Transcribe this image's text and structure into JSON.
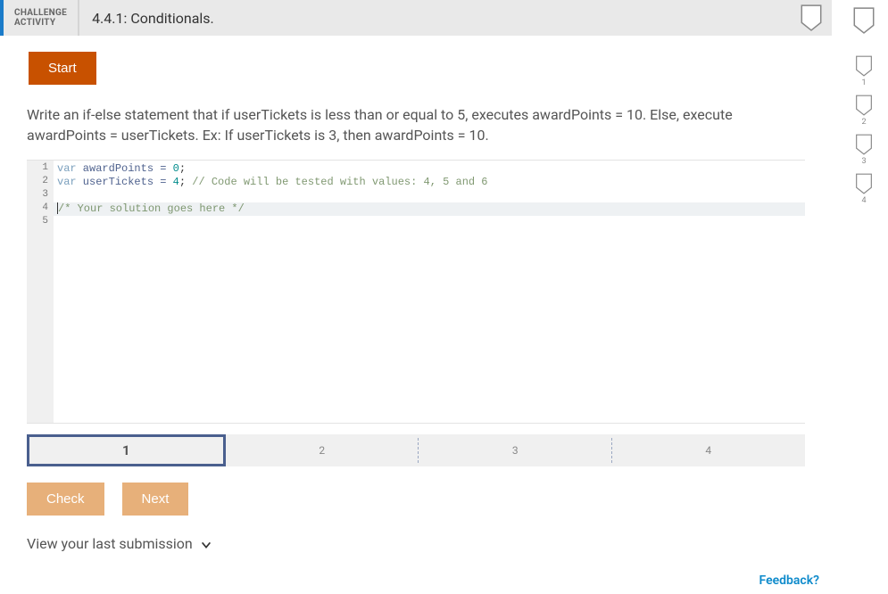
{
  "header": {
    "label_line1": "CHALLENGE",
    "label_line2": "ACTIVITY",
    "title": "4.4.1: Conditionals."
  },
  "buttons": {
    "start": "Start",
    "check": "Check",
    "next": "Next"
  },
  "prompt": "Write an if-else statement that if userTickets is less than or equal to 5, executes awardPoints = 10. Else, execute awardPoints = userTickets. Ex: If userTickets is 3, then awardPoints = 10.",
  "code": {
    "lines": [
      {
        "n": "1",
        "kw": "var",
        "ident": " awardPoints = ",
        "num": "0",
        "tail": ";",
        "cmt": ""
      },
      {
        "n": "2",
        "kw": "var",
        "ident": " userTickets = ",
        "num": "4",
        "tail": "; ",
        "cmt": "// Code will be tested with values: 4, 5 and 6"
      },
      {
        "n": "3",
        "kw": "",
        "ident": "",
        "num": "",
        "tail": "",
        "cmt": ""
      },
      {
        "n": "4",
        "kw": "",
        "ident": "",
        "num": "",
        "tail": "",
        "cmt": "/* Your solution goes here */"
      },
      {
        "n": "5",
        "kw": "",
        "ident": "",
        "num": "",
        "tail": "",
        "cmt": ""
      }
    ]
  },
  "steps": [
    "1",
    "2",
    "3",
    "4"
  ],
  "active_step_index": 0,
  "last_submission_label": "View your last submission",
  "feedback_label": "Feedback?",
  "side_shields": [
    "1",
    "2",
    "3",
    "4"
  ]
}
